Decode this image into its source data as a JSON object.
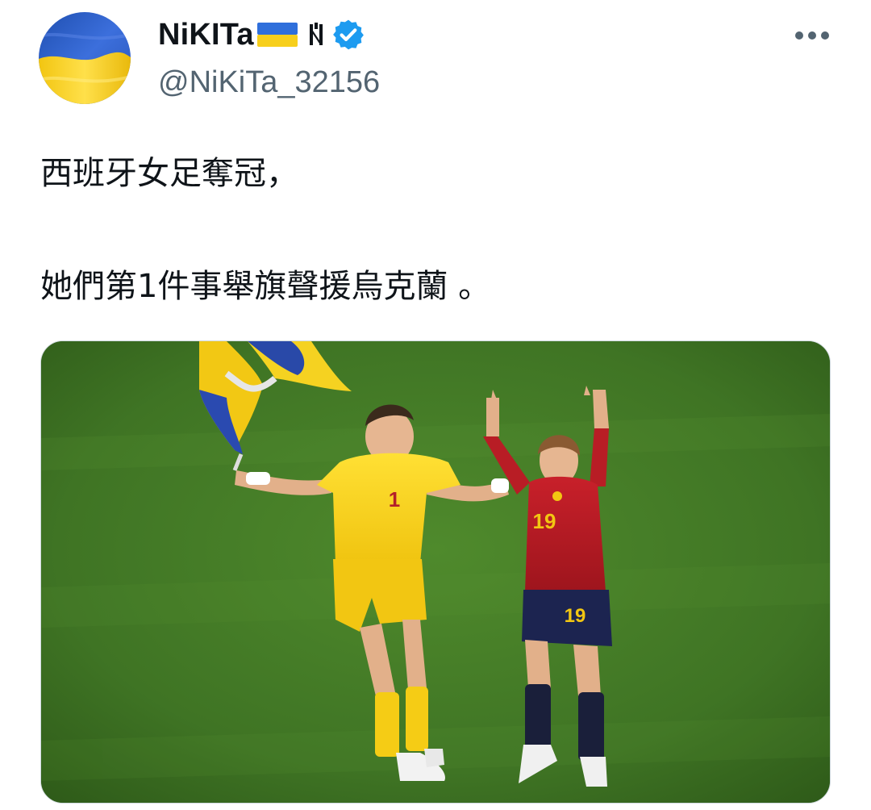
{
  "user": {
    "display_name": "NiKITa",
    "handle": "@NiKiTa_32156",
    "avatar_icon": "ukraine-flag-avatar",
    "flag_icon": "ukraine-flag-emoji",
    "symbol_icon": "trident-icon",
    "verified_icon": "verified-badge-icon"
  },
  "menu": {
    "more_icon": "more-dots-icon"
  },
  "tweet": {
    "lines": [
      "西班牙女足奪冠，",
      "她們第1件事舉旗聲援烏克蘭 。"
    ]
  },
  "media": {
    "goalkeeper_number": "1",
    "player_number_shirt": "19",
    "player_number_shorts": "19"
  },
  "colors": {
    "verified_blue": "#1d9bf0",
    "handle_gray": "#536471",
    "ukraine_blue": "#2f5cc9",
    "ukraine_yellow": "#f5cf1a",
    "pitch_green": "#3f7424"
  }
}
